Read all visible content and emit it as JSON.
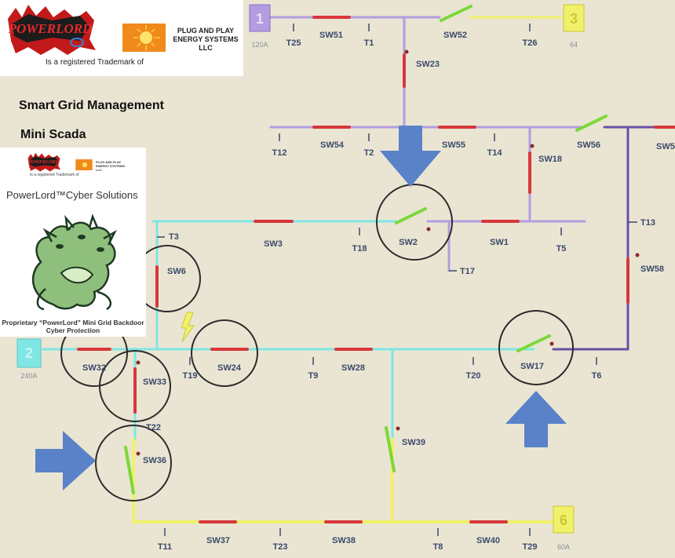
{
  "header": {
    "brand_trademark": "Is a registered Trademark of",
    "company_name": "PLUG AND PLAY ENERGY SYSTEMS LLC",
    "brand_logo_text": "POWERLORD"
  },
  "titles": {
    "main": "Smart Grid Management",
    "sub": "Mini Scada"
  },
  "card": {
    "trademark": "Is a registered Trademark of",
    "company_name": "PLUG AND PLAY ENERGY SYSTEMS LLC",
    "title": "PowerLord™Cyber Solutions",
    "caption": "Proprietary “PowerLord” Mini Grid Backdoor Cyber Protection"
  },
  "colors": {
    "purple": "#b39cdf",
    "dark_purple": "#6a4fa8",
    "cyan": "#7fe6e3",
    "yellow": "#f1f06a",
    "red": "#d7373b",
    "green": "#7cd838",
    "arrow": "#5a82c8",
    "label": "#3a4a6a"
  },
  "sources": {
    "s1": {
      "label": "1",
      "sub": "120A"
    },
    "s2": {
      "label": "2",
      "sub": "240A"
    },
    "s3": {
      "label": "3",
      "sub": "64"
    },
    "s6": {
      "label": "6",
      "sub": "60A"
    }
  },
  "labels": {
    "T25": "T25",
    "SW51": "SW51",
    "T1": "T1",
    "SW52": "SW52",
    "T26": "T26",
    "SW23": "SW23",
    "T12": "T12",
    "SW54": "SW54",
    "T2": "T2",
    "SW55": "SW55",
    "T14": "T14",
    "SW18": "SW18",
    "SW56": "SW56",
    "SW5": "SW5",
    "T13": "T13",
    "SW58": "SW58",
    "T3": "T3",
    "SW3": "SW3",
    "T18": "T18",
    "SW2": "SW2",
    "SW1": "SW1",
    "T5": "T5",
    "T17": "T17",
    "SW6": "SW6",
    "SW32": "SW32",
    "SW33": "SW33",
    "T19": "T19",
    "SW24": "SW24",
    "T9": "T9",
    "SW28": "SW28",
    "T20": "T20",
    "SW17": "SW17",
    "T6": "T6",
    "T22": "T22",
    "SW36": "SW36",
    "SW39": "SW39",
    "T11": "T11",
    "SW37": "SW37",
    "T23": "T23",
    "SW38": "SW38",
    "T8": "T8",
    "SW40": "SW40",
    "T29": "T29"
  }
}
